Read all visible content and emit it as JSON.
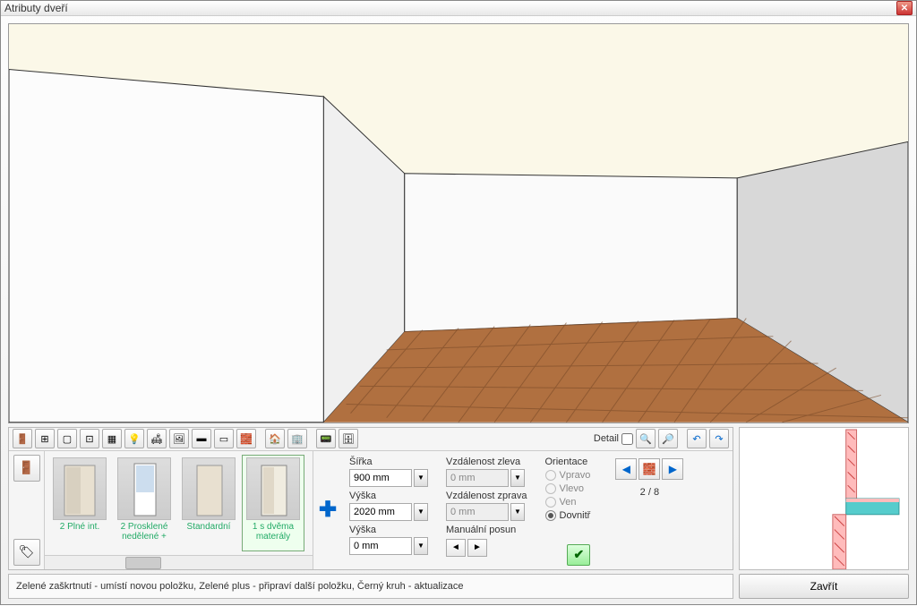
{
  "window": {
    "title": "Atributy dveří"
  },
  "toolbar": {
    "detail_label": "Detail"
  },
  "thumbs": [
    {
      "label": "2 Plné int."
    },
    {
      "label": "2 Prosklené nedělené +"
    },
    {
      "label": "Standardní"
    },
    {
      "label": "1 s dvěma materály"
    }
  ],
  "fields": {
    "width_label": "Šířka",
    "width_value": "900 mm",
    "height_label": "Výška",
    "height_value": "2020 mm",
    "height2_label": "Výška",
    "height2_value": "0 mm",
    "dist_left_label": "Vzdálenost zleva",
    "dist_left_value": "0 mm",
    "dist_right_label": "Vzdálenost zprava",
    "dist_right_value": "0 mm",
    "manual_label": "Manuální posun"
  },
  "orientation": {
    "label": "Orientace",
    "opt_right": "Vpravo",
    "opt_left": "Vlevo",
    "opt_out": "Ven",
    "opt_in": "Dovnitř"
  },
  "wall": {
    "counter": "2 / 8"
  },
  "status": {
    "text": "Zelené zaškrtnutí - umístí novou položku, Zelené plus - připraví další položku, Černý kruh - aktualizace"
  },
  "buttons": {
    "close": "Zavřít"
  }
}
